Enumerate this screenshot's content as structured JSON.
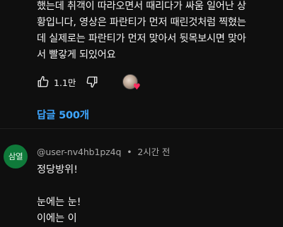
{
  "top_comment": {
    "lines": [
      "했는데 취객이 따라오면서 때리다가 싸움 일어난 상",
      "황입니다, 영상은 파란티가 먼저 때린것처럼 찍혔는",
      "데 실제로는 파란티가 먼저 맞아서 뒷목보시면 맞아",
      "서 빨갛게 되있어요"
    ],
    "like_count": "1.1만",
    "icons": {
      "like": "thumbs-up-icon",
      "dislike": "thumbs-down-icon",
      "creator_heart": "heart-icon"
    },
    "replies_label": "답글 500개"
  },
  "reply_comment": {
    "avatar_text": "삼열",
    "author": "@user-nv4hb1pz4q",
    "separator": "•",
    "time": "2시간 전",
    "lines": [
      "정당방위!",
      "",
      "눈에는 눈!"
    ],
    "partial_line": "이에는 이"
  },
  "colors": {
    "background": "#0f0f0f",
    "link": "#3ea6ff",
    "avatar_bg": "#0f7a3a",
    "heart": "#ff2b5e",
    "meta_text": "#aaaaaa"
  }
}
